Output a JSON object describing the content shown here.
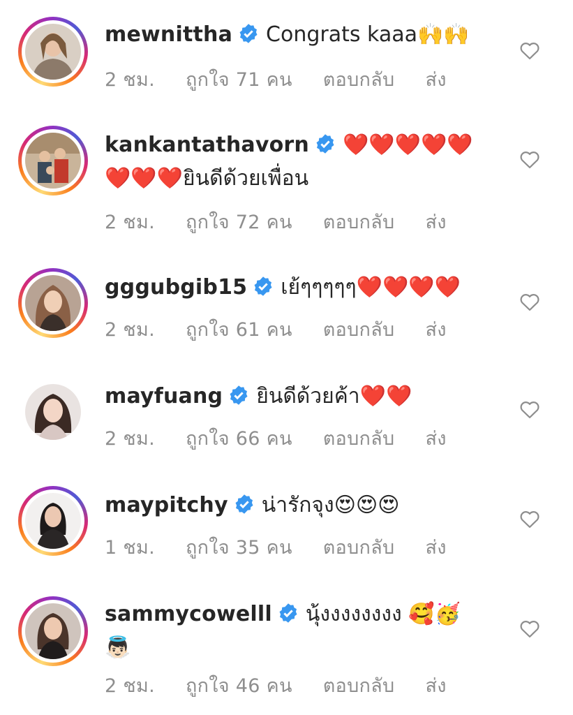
{
  "comments": [
    {
      "username": "mewnittha",
      "text": "Congrats kaaa🙌🙌",
      "text_line2": "",
      "time": "2 ชม.",
      "likes": "ถูกใจ 71 คน",
      "reply": "ตอบกลับ",
      "send": "ส่ง",
      "avatar_ring": true
    },
    {
      "username": "kankantathavorn",
      "text": "❤️❤️❤️❤️❤️",
      "text_line2": "❤️❤️❤️ยินดีด้วยเพื่อน",
      "time": "2 ชม.",
      "likes": "ถูกใจ 72 คน",
      "reply": "ตอบกลับ",
      "send": "ส่ง",
      "avatar_ring": true
    },
    {
      "username": "gggubgib15",
      "text": "เย้ๆๆๆๆๆ❤️❤️❤️❤️",
      "text_line2": "",
      "time": "2 ชม.",
      "likes": "ถูกใจ 61 คน",
      "reply": "ตอบกลับ",
      "send": "ส่ง",
      "avatar_ring": true
    },
    {
      "username": "mayfuang",
      "text": "ยินดีด้วยค้า❤️❤️",
      "text_line2": "",
      "time": "2 ชม.",
      "likes": "ถูกใจ 66 คน",
      "reply": "ตอบกลับ",
      "send": "ส่ง",
      "avatar_ring": false
    },
    {
      "username": "maypitchy",
      "text": "น่ารักจุง😍😍😍",
      "text_line2": "",
      "time": "1 ชม.",
      "likes": "ถูกใจ 35 คน",
      "reply": "ตอบกลับ",
      "send": "ส่ง",
      "avatar_ring": true
    },
    {
      "username": "sammycowelll",
      "text": "นุ้งงงงงงงง 🥰🥳",
      "text_line2": "👼🏻",
      "time": "2 ชม.",
      "likes": "ถูกใจ 46 คน",
      "reply": "ตอบกลับ",
      "send": "ส่ง",
      "avatar_ring": true
    }
  ],
  "colors": {
    "text": "#262626",
    "secondary": "#8e8e8e",
    "verified": "#3897f0",
    "ring_start": "#feda75",
    "ring_end": "#d62976"
  },
  "icons": {
    "verified": "verified-badge-icon",
    "like": "heart-outline-icon"
  }
}
